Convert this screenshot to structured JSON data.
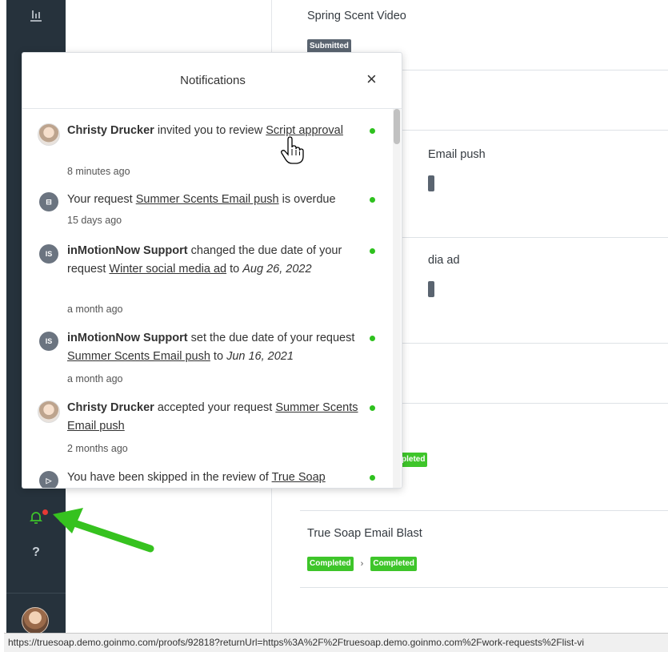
{
  "sidebar": {
    "icons": [
      "analytics-icon",
      "bell-icon",
      "help-icon"
    ],
    "help_label": "?"
  },
  "list": {
    "cards": [
      {
        "title": "Spring Scent Video",
        "badge": "Submitted"
      },
      {
        "title_fragment": "Email push"
      },
      {
        "title_fragment": "dia ad"
      },
      {
        "badge_fragment": "pleted"
      },
      {
        "title": "True Soap Email Blast",
        "badges": [
          "Completed",
          "Completed"
        ]
      }
    ]
  },
  "notifications": {
    "title": "Notifications",
    "close_label": "×",
    "items": [
      {
        "avatar": "photo",
        "actor": "Christy Drucker",
        "text1": " invited you to review ",
        "link": "Script approval",
        "time": "8 minutes ago",
        "unread": true
      },
      {
        "avatar": "icon",
        "avatar_label": "⊟",
        "text1": "Your request ",
        "link": "Summer Scents Email push",
        "text2": " is overdue",
        "time": "15 days ago",
        "unread": true
      },
      {
        "avatar": "initials",
        "avatar_label": "IS",
        "actor": "inMotionNow Support",
        "text1": " changed the due date of your request ",
        "link": "Winter social media ad",
        "text2": " to ",
        "date": "Aug 26, 2022",
        "time": "a month ago",
        "unread": true
      },
      {
        "avatar": "initials",
        "avatar_label": "IS",
        "actor": "inMotionNow Support",
        "text1": " set the due date of your request ",
        "link": "Summer Scents Email push",
        "text2": " to ",
        "date": "Jun 16, 2021",
        "time": "a month ago",
        "unread": true
      },
      {
        "avatar": "photo",
        "actor": "Christy Drucker",
        "text1": " accepted your request ",
        "link": "Summer Scents Email push",
        "time": "2 months ago",
        "unread": true
      },
      {
        "avatar": "icon",
        "avatar_label": "▷",
        "text1": "You have been skipped in the review of ",
        "link": "True Soap",
        "unread": true
      }
    ]
  },
  "statusbar": {
    "url": "https://truesoap.demo.goinmo.com/proofs/92818?returnUrl=https%3A%2F%2Ftruesoap.demo.goinmo.com%2Fwork-requests%2Flist-vi"
  },
  "colors": {
    "sidebar": "#26323c",
    "accent_green": "#3ec52a",
    "badge_grey": "#5a6470",
    "unread_dot": "#2ec11e"
  }
}
